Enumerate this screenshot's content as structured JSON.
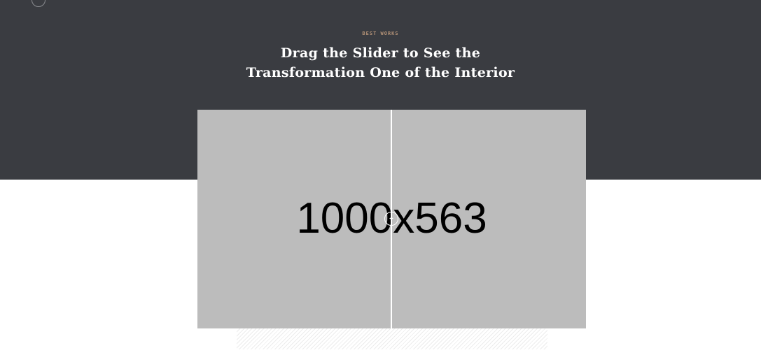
{
  "section": {
    "eyebrow": "BEST WORKS",
    "heading_line1": "Drag the Slider to See the",
    "heading_line2": "Transformation One of the Interior"
  },
  "slider": {
    "placeholder_text": "1000x563",
    "handle_icon": "left-right-arrows-icon",
    "position_fraction": 0.5
  },
  "colors": {
    "dark_band": "#3a3c41",
    "eyebrow": "#b59378",
    "image_placeholder": "#bcbcbc"
  }
}
